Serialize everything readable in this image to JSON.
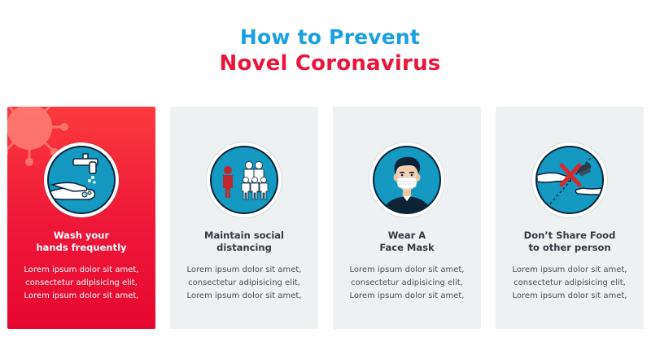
{
  "title": {
    "line1": "How to Prevent",
    "line2": "Novel Coronavirus"
  },
  "colors": {
    "title_blue": "#1aa0de",
    "title_red": "#e8163a",
    "card_active_top": "#fb3a3d",
    "card_active_bottom": "#e6082f",
    "card_bg": "#eef1f2",
    "icon_bg": "#1499c3"
  },
  "cards": [
    {
      "icon": "hand-washing-icon",
      "active": true,
      "title_line1": "Wash your",
      "title_line2": "hands frequently",
      "body_line1": "Lorem ipsum dolor sit amet,",
      "body_line2": "consectetur adipisicing elit,",
      "body_line3": "Lorem ipsum dolor sit amet,"
    },
    {
      "icon": "social-distancing-icon",
      "active": false,
      "title_line1": "Maintain social",
      "title_line2": "distancing",
      "body_line1": "Lorem ipsum dolor sit amet,",
      "body_line2": "consectetur adipisicing elit,",
      "body_line3": "Lorem ipsum dolor sit amet,"
    },
    {
      "icon": "face-mask-icon",
      "active": false,
      "title_line1": "Wear A",
      "title_line2": "Face Mask",
      "body_line1": "Lorem ipsum dolor sit amet,",
      "body_line2": "consectetur adipisicing elit,",
      "body_line3": "Lorem ipsum dolor sit amet,"
    },
    {
      "icon": "no-food-sharing-icon",
      "active": false,
      "title_line1": "Don’t Share Food",
      "title_line2": "to other person",
      "body_line1": "Lorem ipsum dolor sit amet,",
      "body_line2": "consectetur adipisicing elit,",
      "body_line3": "Lorem ipsum dolor sit amet,"
    }
  ]
}
